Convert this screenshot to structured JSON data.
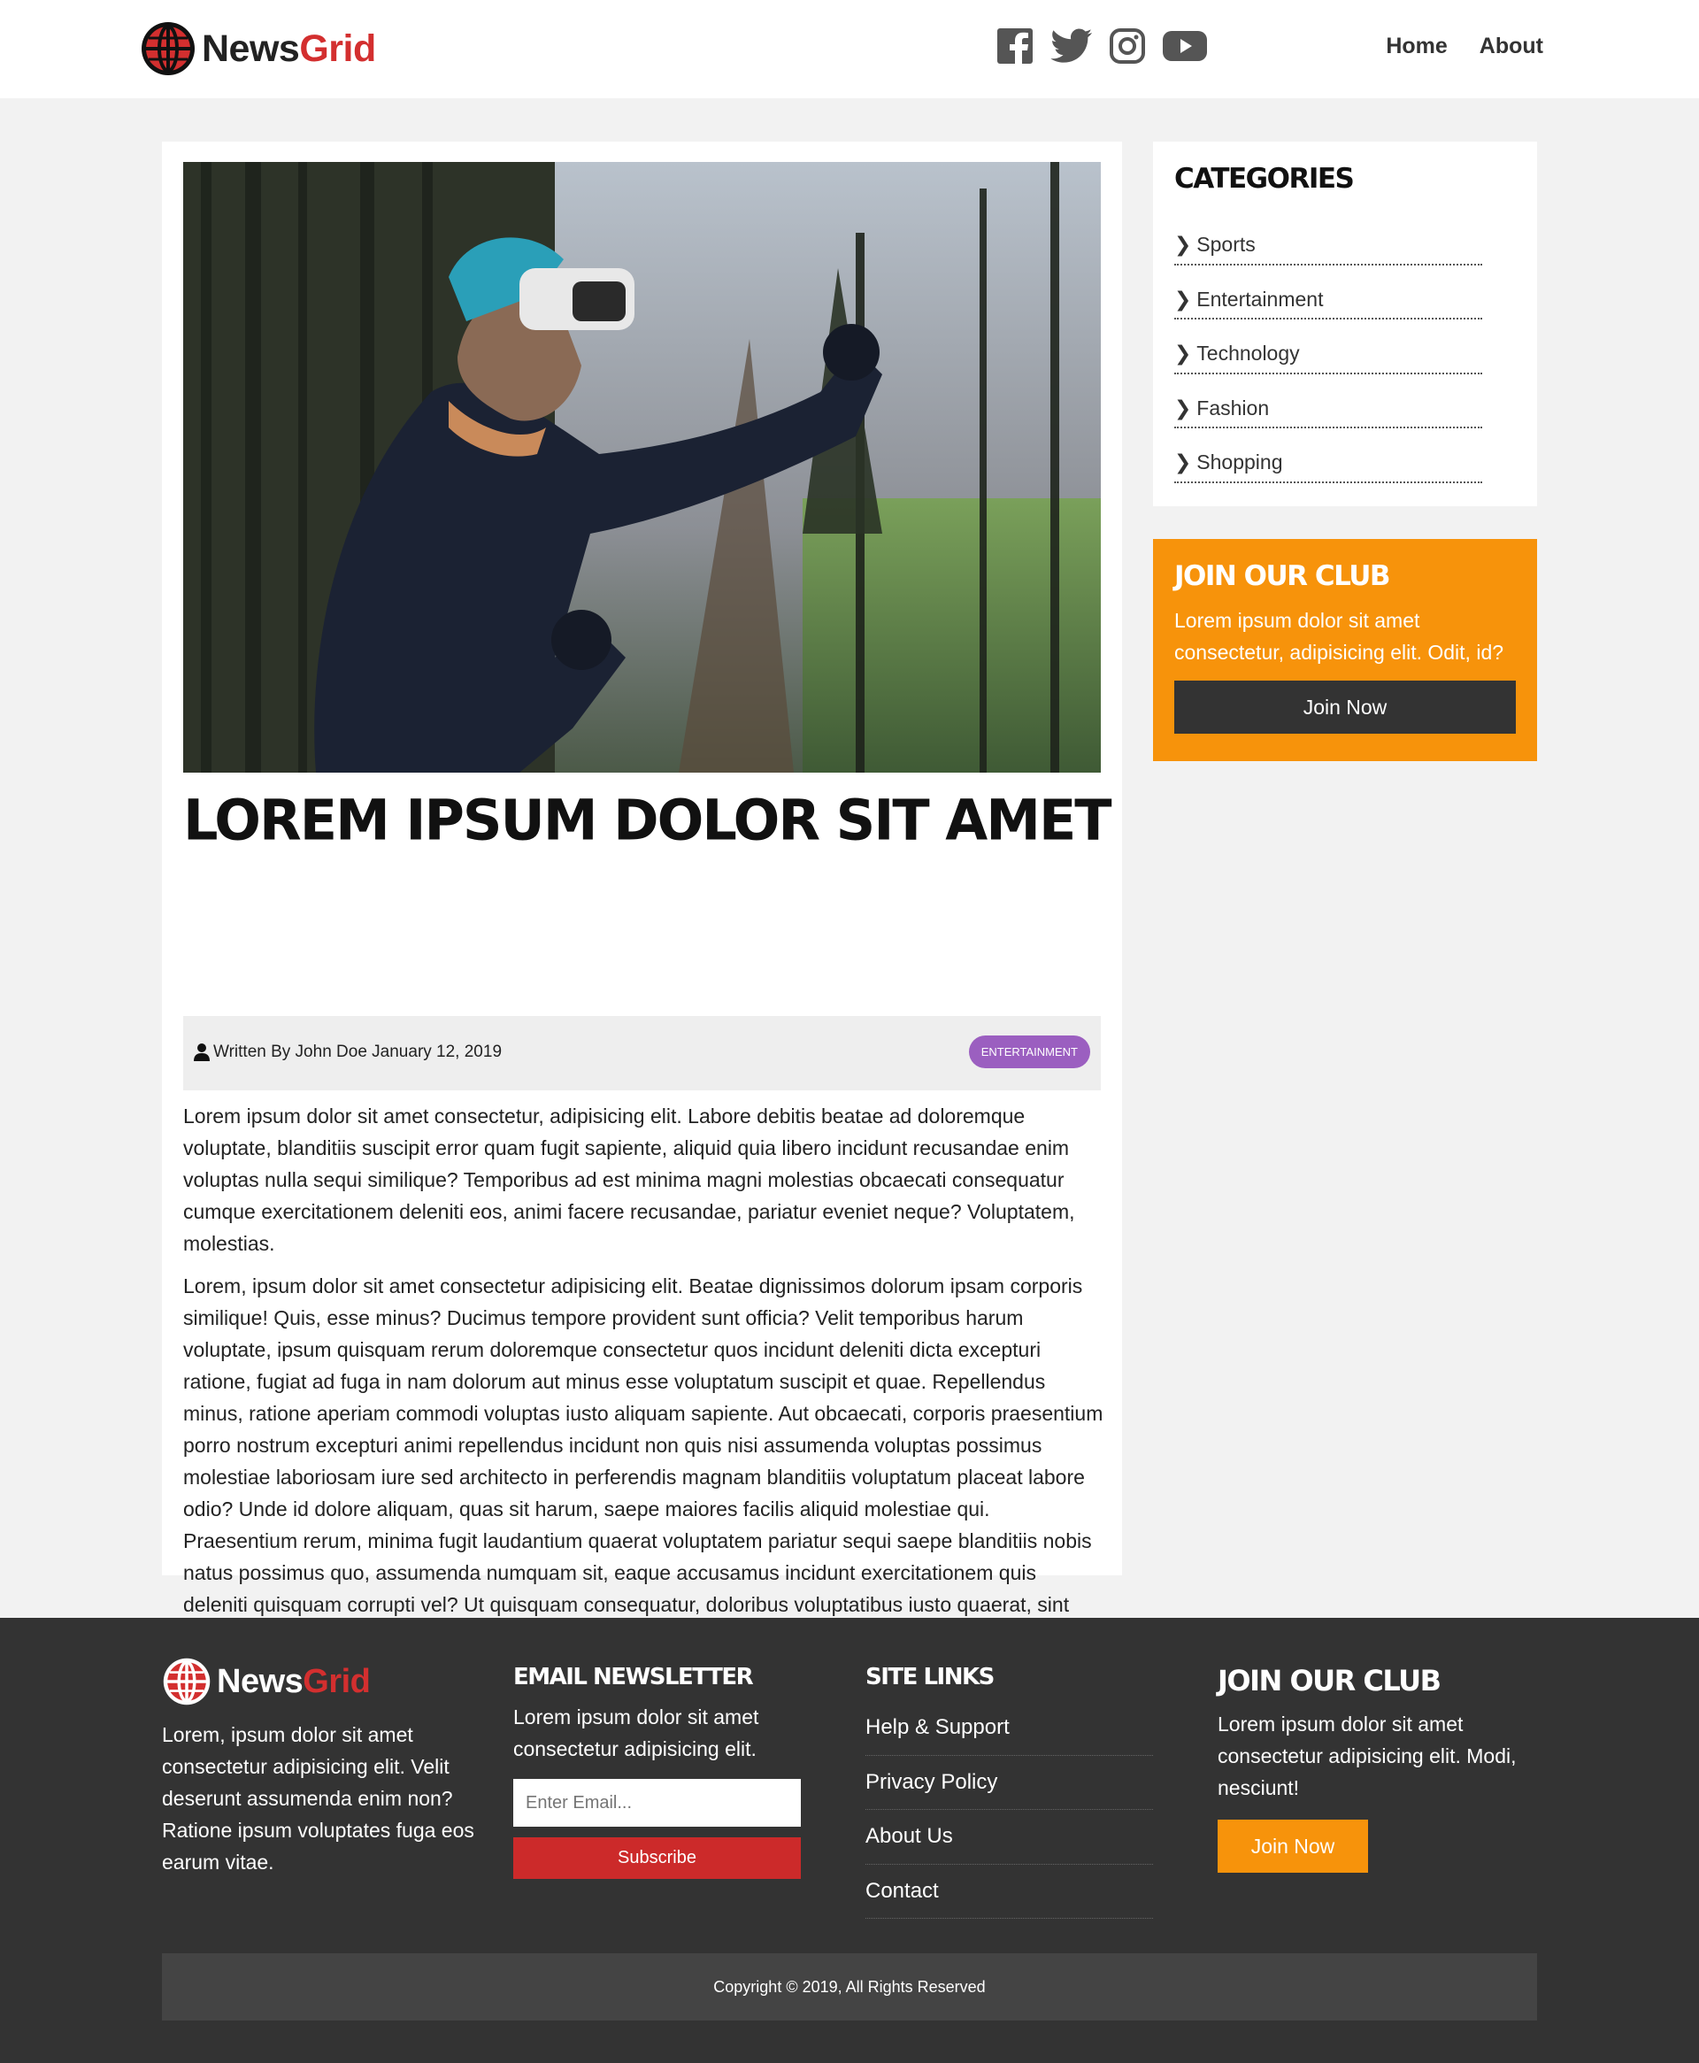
{
  "header": {
    "brand_part1": "News",
    "brand_part2": "Grid",
    "socials": [
      "facebook-icon",
      "twitter-icon",
      "instagram-icon",
      "youtube-icon"
    ],
    "nav": [
      "Home",
      "About"
    ]
  },
  "article": {
    "title": "Lorem Ipsum Dolor Sit Amet",
    "author": "Written By John Doe January 12, 2019",
    "tag": "Entertainment",
    "tag_color": "#9b5fc0",
    "paragraphs": [
      "Lorem ipsum dolor sit amet consectetur, adipisicing elit. Labore debitis beatae ad doloremque voluptate, blanditiis suscipit error quam fugit sapiente, aliquid quia libero incidunt recusandae enim voluptas nulla sequi similique? Temporibus ad est minima magni molestias obcaecati consequatur cumque exercitationem deleniti eos, animi facere recusandae, pariatur eveniet neque? Voluptatem, molestias.",
      "Lorem, ipsum dolor sit amet consectetur adipisicing elit. Beatae dignissimos dolorum ipsam corporis similique! Quis, esse minus? Ducimus tempore provident sunt officia? Velit temporibus harum voluptate, ipsum quisquam rerum doloremque consectetur quos incidunt deleniti dicta excepturi ratione, fugiat ad fuga in nam dolorum aut minus esse voluptatum suscipit et quae. Repellendus minus, ratione aperiam commodi voluptas iusto aliquam sapiente. Aut obcaecati, corporis praesentium porro nostrum excepturi animi repellendus incidunt non quis nisi assumenda voluptas possimus molestiae laboriosam iure sed architecto in perferendis magnam blanditiis voluptatum placeat labore odio? Unde id dolore aliquam, quas sit harum, saepe maiores facilis aliquid molestiae qui. Praesentium rerum, minima fugit laudantium quaerat voluptatem pariatur sequi saepe blanditiis nobis natus possimus quo, assumenda numquam sit, eaque accusamus incidunt exercitationem quis deleniti quisquam corrupti vel? Ut quisquam consequatur, doloribus voluptatibus iusto quaerat, sint non magnam reiciendis amet quos sapiente excepturi omnis laboriosam nobis, expedita delectus odio provident?"
    ]
  },
  "sidebar": {
    "categories_heading": "Categories",
    "categories": [
      "Sports",
      "Entertainment",
      "Technology",
      "Fashion",
      "Shopping"
    ],
    "club": {
      "heading": "Join Our Club",
      "text": "Lorem ipsum dolor sit amet consectetur, adipisicing elit. Odit, id?",
      "button": "Join Now",
      "color": "#f7930b"
    }
  },
  "footer": {
    "about_text": "Lorem, ipsum dolor sit amet consectetur adipisicing elit. Velit deserunt assumenda enim non? Ratione ipsum voluptates fuga eos earum vitae.",
    "newsletter": {
      "heading": "Email Newsletter",
      "text": "Lorem ipsum dolor sit amet consectetur adipisicing elit.",
      "placeholder": "Enter Email...",
      "button": "Subscribe"
    },
    "site_links": {
      "heading": "Site Links",
      "items": [
        "Help & Support",
        "Privacy Policy",
        "About Us",
        "Contact"
      ]
    },
    "club": {
      "heading": "Join Our Club",
      "text": "Lorem ipsum dolor sit amet consectetur adipisicing elit. Modi, nesciunt!",
      "button": "Join Now"
    },
    "copyright": "Copyright © 2019, All Rights Reserved"
  }
}
